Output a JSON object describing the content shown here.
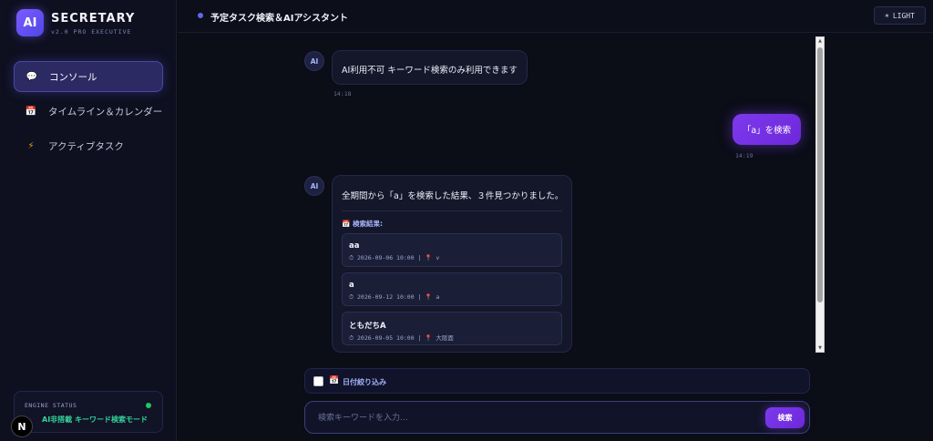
{
  "app": {
    "logo": "AI",
    "name": "SECRETARY",
    "version": "v2.0 PRO EXECUTIVE"
  },
  "sidebar": {
    "items": [
      {
        "label": "コンソール",
        "icon": "chat-bubble-icon",
        "glyph": "💬",
        "active": true
      },
      {
        "label": "タイムライン＆カレンダー",
        "icon": "calendar-icon",
        "glyph": "📅",
        "active": false
      },
      {
        "label": "アクティブタスク",
        "icon": "lightning-icon",
        "glyph": "⚡",
        "active": false
      }
    ],
    "engine": {
      "title": "ENGINE STATUS",
      "status": "AI非搭載 キーワード検索モード",
      "status_color": "#34d399"
    },
    "n_badge": "N"
  },
  "header": {
    "title": "予定タスク検索＆AIアシスタント",
    "theme_button": "LIGHT",
    "theme_icon": "☀"
  },
  "chat": {
    "messages": [
      {
        "role": "ai",
        "avatar": "AI",
        "text": "AI利用不可 キーワード検索のみ利用できます",
        "time": "14:18"
      },
      {
        "role": "user",
        "text": "「a」を検索",
        "time": "14:19"
      },
      {
        "role": "ai",
        "avatar": "AI",
        "text": "全期間から「a」を検索した結果、３件見つかりました。",
        "results_heading": "検索結果:",
        "results_icon": "📅",
        "results": [
          {
            "title": "aa",
            "datetime": "2026-09-06 10:00",
            "location": "v"
          },
          {
            "title": "a",
            "datetime": "2026-09-12 10:00",
            "location": "a"
          },
          {
            "title": "ともだちA",
            "datetime": "2026-09-05 10:00",
            "location": "大阪面"
          }
        ]
      }
    ]
  },
  "filter": {
    "label": "日付絞り込み",
    "checked": false
  },
  "search": {
    "placeholder": "検索キーワードを入力...",
    "value": "",
    "button_label": "検索"
  },
  "colors": {
    "accent": "#6d28d9",
    "background": "#0b0d17"
  }
}
